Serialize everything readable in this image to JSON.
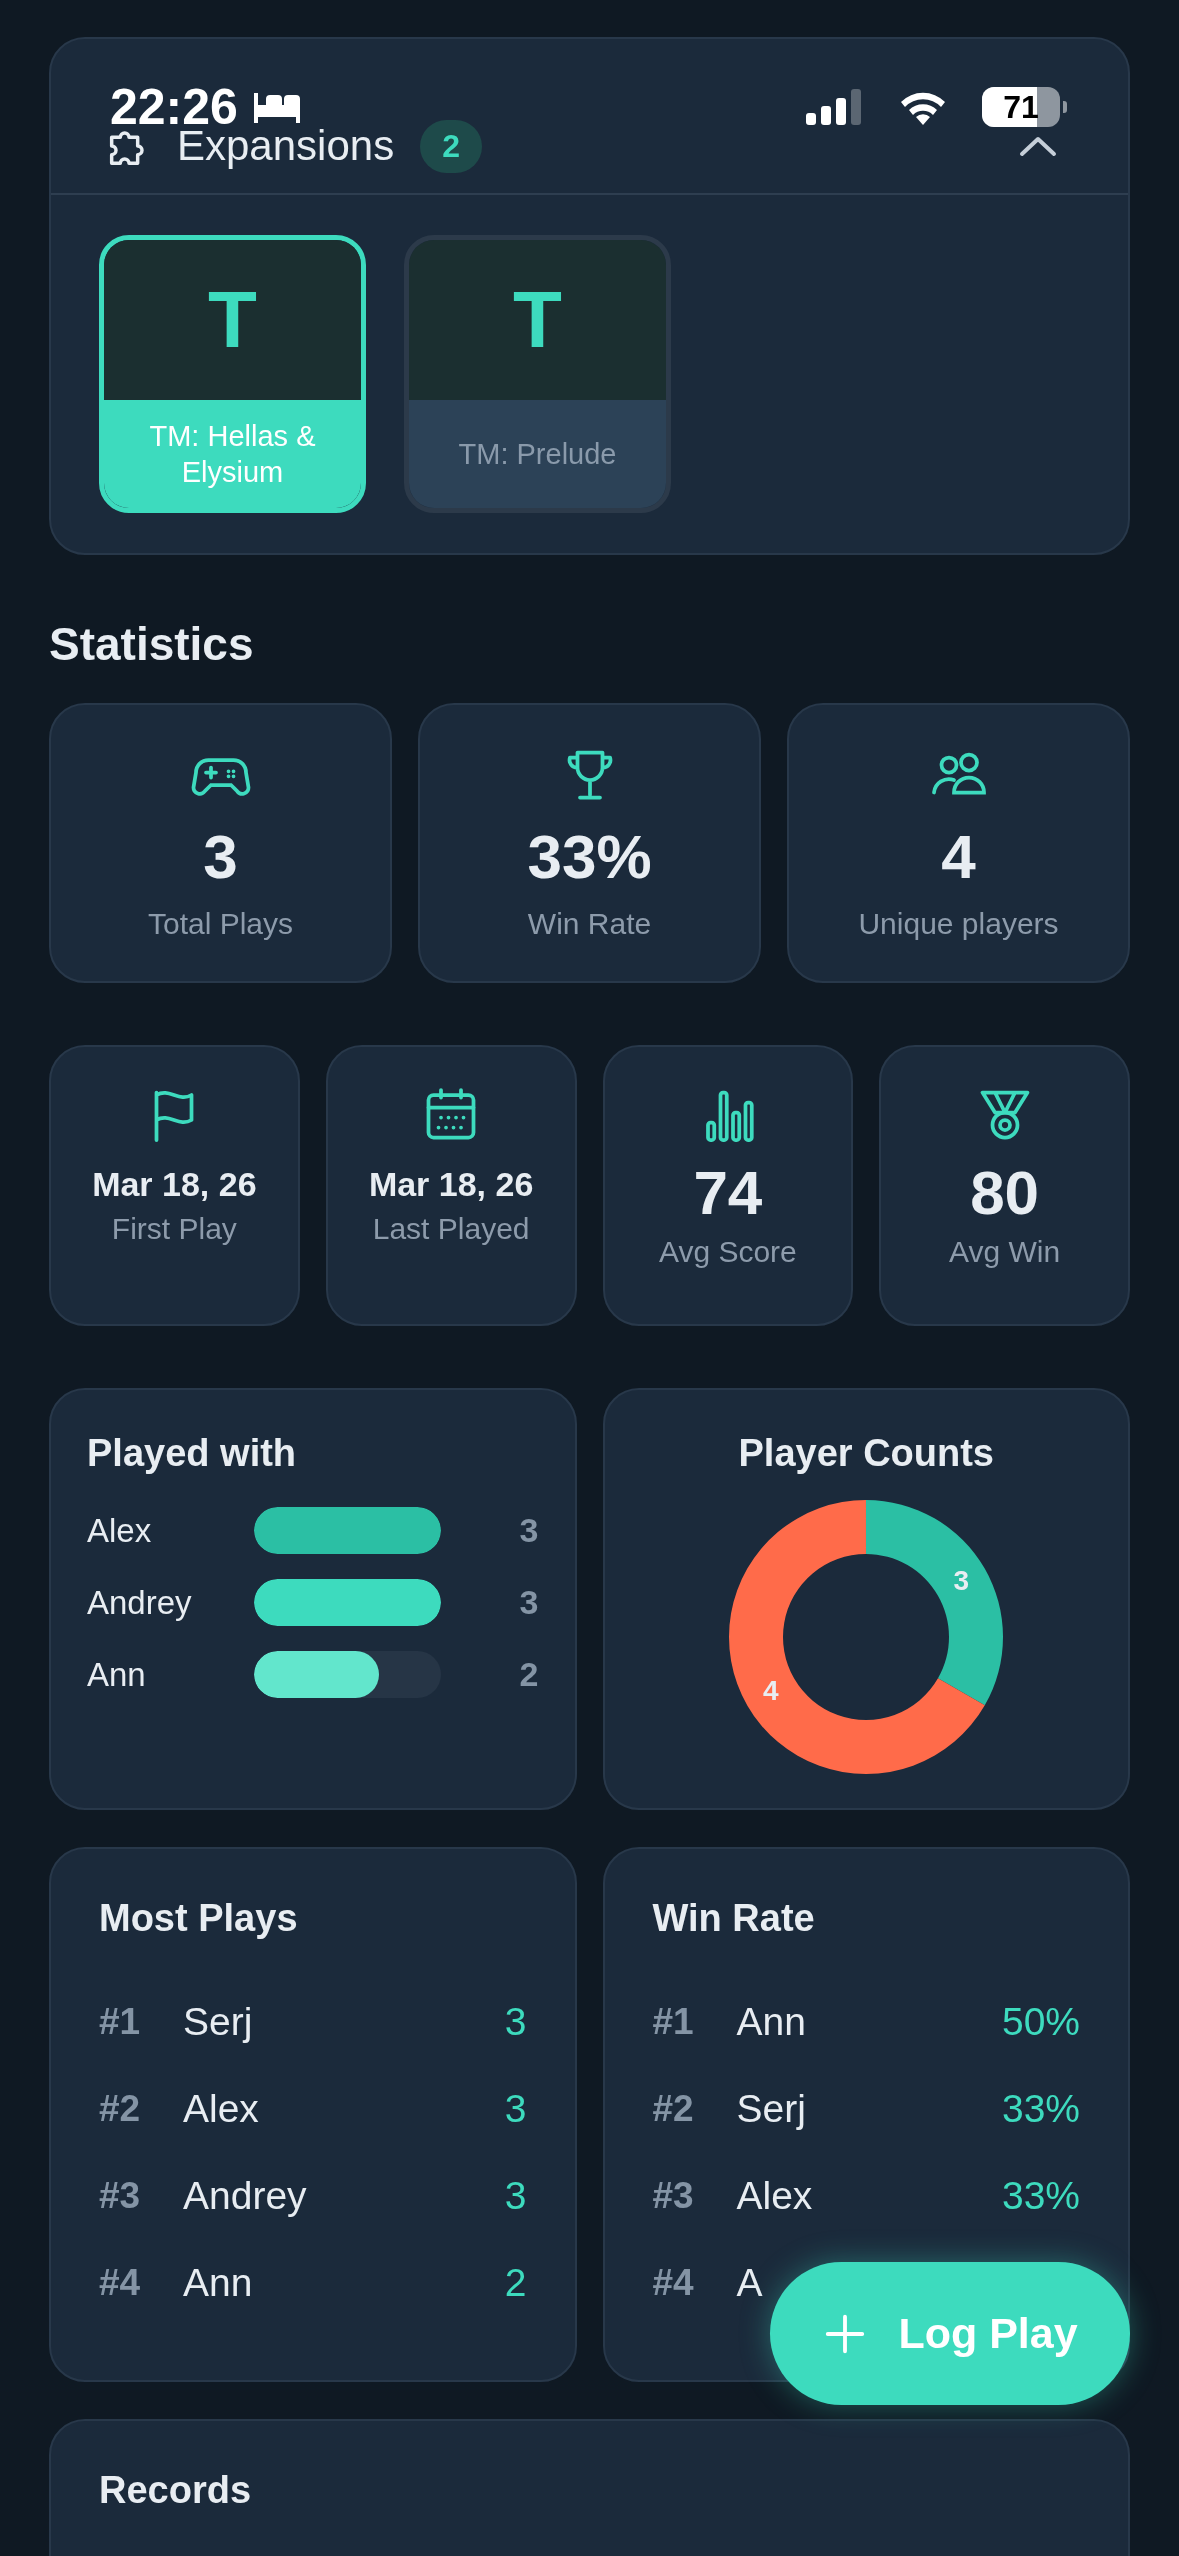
{
  "status_bar": {
    "time": "22:26",
    "battery": "71"
  },
  "expansions": {
    "title": "Expansions",
    "count": "2",
    "expanded": true,
    "items": [
      {
        "initial": "T",
        "name": "TM: Hellas & Elysium",
        "selected": true
      },
      {
        "initial": "T",
        "name": "TM: Prelude",
        "selected": false
      }
    ]
  },
  "statistics": {
    "title": "Statistics",
    "row_1": [
      {
        "kind": "plays",
        "value": "3",
        "label": "Total Plays"
      },
      {
        "kind": "winrate",
        "value": "33%",
        "label": "Win Rate"
      },
      {
        "kind": "players",
        "value": "4",
        "label": "Unique players"
      }
    ],
    "row_2": [
      {
        "kind": "first",
        "value": "Mar 18, 26",
        "label": "First Play"
      },
      {
        "kind": "last",
        "value": "Mar 18, 26",
        "label": "Last Played"
      },
      {
        "kind": "score",
        "value": "74",
        "label": "Avg Score"
      },
      {
        "kind": "win",
        "value": "80",
        "label": "Avg Win"
      }
    ]
  },
  "played_with": {
    "title": "Played with",
    "items": [
      {
        "name": "Alex",
        "level": 1,
        "color": "#2bbfa4",
        "count": "3"
      },
      {
        "name": "Andrey",
        "level": 1,
        "color": "#3ddbbe",
        "count": "3"
      },
      {
        "name": "Ann",
        "level": 0.667,
        "color": "#62e6cc",
        "count": "2"
      }
    ]
  },
  "player_counts": {
    "title": "Player Counts",
    "chart_data": {
      "type": "donut",
      "categories": [
        "3",
        "4"
      ],
      "values": [
        33.3,
        66.7
      ],
      "colors": [
        "#2bbfa4",
        "#ff6b4a"
      ]
    }
  },
  "most_plays": {
    "title": "Most Plays",
    "rows": [
      {
        "rank": "#1",
        "name": "Serj",
        "value": "3"
      },
      {
        "rank": "#2",
        "name": "Alex",
        "value": "3"
      },
      {
        "rank": "#3",
        "name": "Andrey",
        "value": "3"
      },
      {
        "rank": "#4",
        "name": "Ann",
        "value": "2"
      }
    ]
  },
  "win_rate": {
    "title": "Win Rate",
    "rows": [
      {
        "rank": "#1",
        "name": "Ann",
        "value": "50%"
      },
      {
        "rank": "#2",
        "name": "Serj",
        "value": "33%"
      },
      {
        "rank": "#3",
        "name": "Alex",
        "value": "33%"
      },
      {
        "rank": "#4",
        "name": "A"
      }
    ]
  },
  "records": {
    "title": "Records"
  },
  "fab": {
    "label": "Log Play"
  }
}
